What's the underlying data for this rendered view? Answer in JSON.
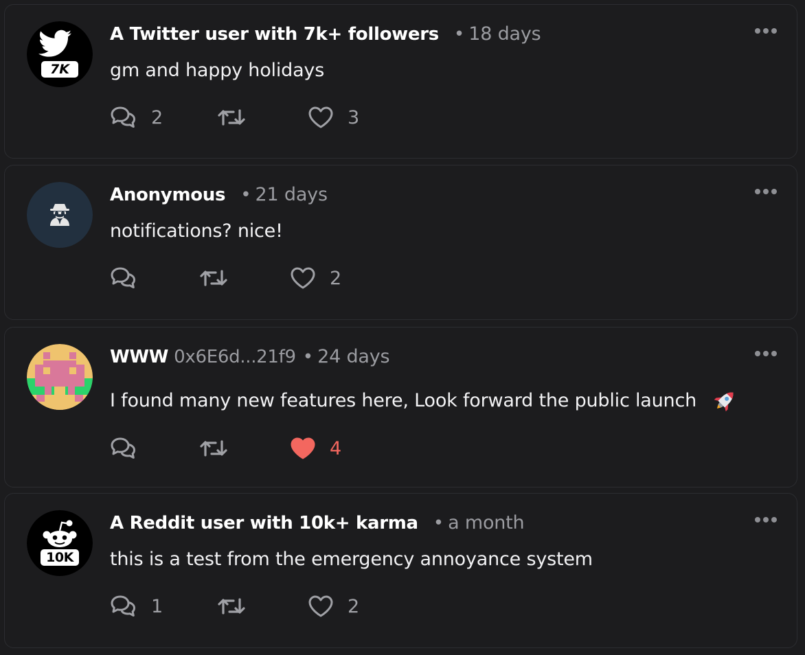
{
  "colors": {
    "background": "#1c1c1e",
    "card_border": "#2c2d31",
    "muted_text": "#9b9ca1",
    "liked": "#f3675f"
  },
  "posts": [
    {
      "avatar_icon": "twitter-bird-icon",
      "avatar_badge": "7K",
      "author": "A Twitter user with 7k+ followers",
      "address": "",
      "separator": "•",
      "time": "18 days",
      "content": "gm and happy holidays",
      "reply_count": "2",
      "repost_count": "",
      "like_count": "3",
      "liked": false
    },
    {
      "avatar_icon": "incognito-spy-icon",
      "avatar_badge": "",
      "author": "Anonymous",
      "address": "",
      "separator": "•",
      "time": "21 days",
      "content": "notifications? nice!",
      "reply_count": "",
      "repost_count": "",
      "like_count": "2",
      "liked": false
    },
    {
      "avatar_icon": "pixel-art-avatar",
      "avatar_badge": "",
      "author": "WWW",
      "address": "0x6E6d...21f9",
      "separator": "•",
      "time": "24 days",
      "content": "I found many new features here, Look forward the public launch",
      "content_emoji": "rocket-icon",
      "reply_count": "",
      "repost_count": "",
      "like_count": "4",
      "liked": true
    },
    {
      "avatar_icon": "reddit-alien-icon",
      "avatar_badge": "10K",
      "author": "A Reddit user with 10k+ karma",
      "address": "",
      "separator": "•",
      "time": "a month",
      "content": "this is a test from the emergency annoyance system",
      "reply_count": "1",
      "repost_count": "",
      "like_count": "2",
      "liked": false
    }
  ]
}
